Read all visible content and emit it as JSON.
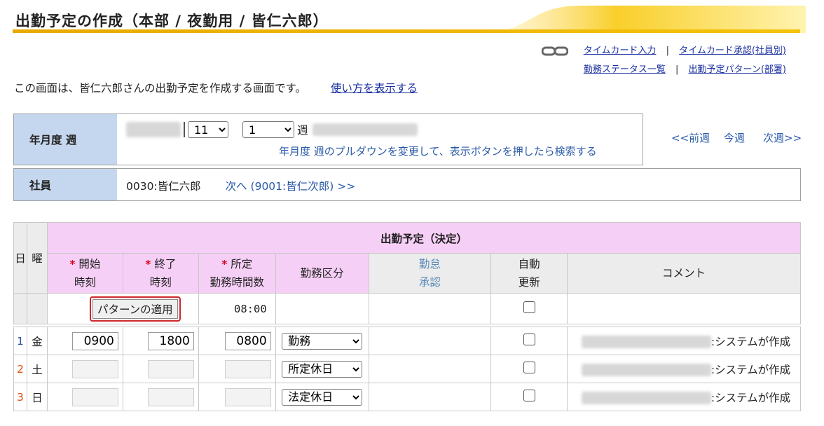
{
  "header": {
    "title": "出勤予定の作成（本部 / 夜勤用 / 皆仁六郎）"
  },
  "links": {
    "timecard_input": "タイムカード入力",
    "timecard_approval": "タイムカード承認(社員別)",
    "status_list": "勤務ステータス一覧",
    "schedule_pattern": "出勤予定パターン(部署)",
    "separator": "|",
    "chain_icon": "chain-link-icon"
  },
  "description": {
    "text": "この画面は、皆仁六郎さんの出勤予定を作成する画面です。",
    "help_link": "使い方を表示する"
  },
  "period": {
    "label": "年月度 週",
    "month_value": "11",
    "week_value": "1",
    "week_suffix": "週",
    "hint": "年月度 週のプルダウンを変更して、表示ボタンを押したら検索する",
    "prev_week": "<<前週",
    "this_week": "今週",
    "next_week": "次週>>"
  },
  "employee": {
    "label": "社員",
    "value": "0030:皆仁六郎",
    "next_link": "次へ (9001:皆仁次郎) >>"
  },
  "table": {
    "group_header": "出勤予定（決定）",
    "col_day": "日",
    "col_weekday": "曜",
    "required_mark": "*",
    "col_start_1": "開始",
    "col_start_2": "時刻",
    "col_end_1": "終了",
    "col_end_2": "時刻",
    "col_hours_1": "所定",
    "col_hours_2": "勤務時間数",
    "col_type": "勤務区分",
    "col_approval_1": "勤怠",
    "col_approval_2": "承認",
    "col_auto_1": "自動",
    "col_auto_2": "更新",
    "col_comment": "コメント",
    "apply_button": "パターンの適用",
    "default_hours": "08:00",
    "rows": [
      {
        "day": "1",
        "weekday": "金",
        "start": "0900",
        "end": "1800",
        "hours": "0800",
        "type": "勤務",
        "comment": ":システムが作成"
      },
      {
        "day": "2",
        "weekday": "土",
        "start": "",
        "end": "",
        "hours": "",
        "type": "所定休日",
        "comment": ":システムが作成"
      },
      {
        "day": "3",
        "weekday": "日",
        "start": "",
        "end": "",
        "hours": "",
        "type": "法定休日",
        "comment": ":システムが作成"
      }
    ]
  },
  "colors": {
    "label_bg": "#c5d7ee",
    "pink_header": "#f6cff6",
    "accent_gold": "#e7a900",
    "link_blue": "#1a2fa0",
    "weekend_red": "#e0001a"
  }
}
